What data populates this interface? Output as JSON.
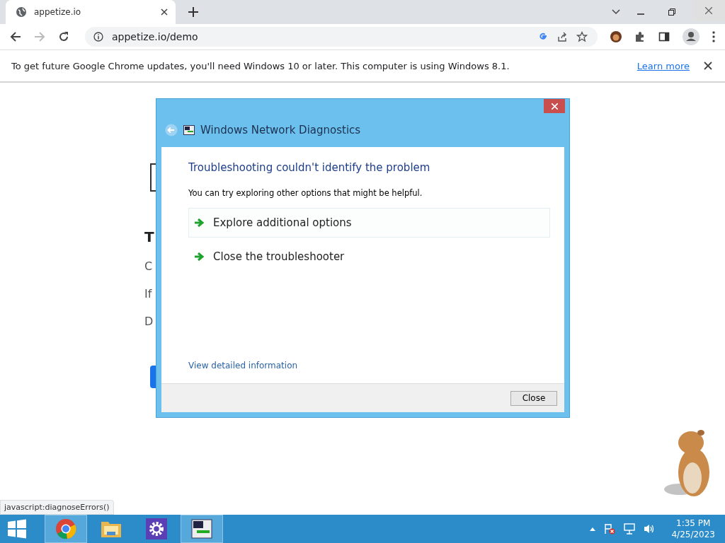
{
  "browser": {
    "tab": {
      "title": "appetize.io",
      "selected": true
    },
    "url": "appetize.io/demo"
  },
  "infobar": {
    "message": "To get future Google Chrome updates, you'll need Windows 10 or later. This computer is using Windows 8.1.",
    "link": "Learn more"
  },
  "page_fragments": [
    "T",
    "C",
    "If",
    "D"
  ],
  "dialog": {
    "title": "Windows Network Diagnostics",
    "heading": "Troubleshooting couldn't identify the problem",
    "message": "You can try exploring other options that might be helpful.",
    "options": [
      {
        "label": "Explore additional options",
        "selected": true
      },
      {
        "label": "Close the troubleshooter",
        "selected": false
      }
    ],
    "details_link": "View detailed information",
    "button": "Close"
  },
  "status_bubble": "javascript:diagnoseErrors()",
  "taskbar": {
    "apps": [
      {
        "kind": "chrome",
        "active": true
      },
      {
        "kind": "folder",
        "active": false
      },
      {
        "kind": "settings",
        "active": false
      },
      {
        "kind": "network",
        "active": true
      }
    ],
    "time": "1:35 PM",
    "date": "4/25/2023"
  }
}
